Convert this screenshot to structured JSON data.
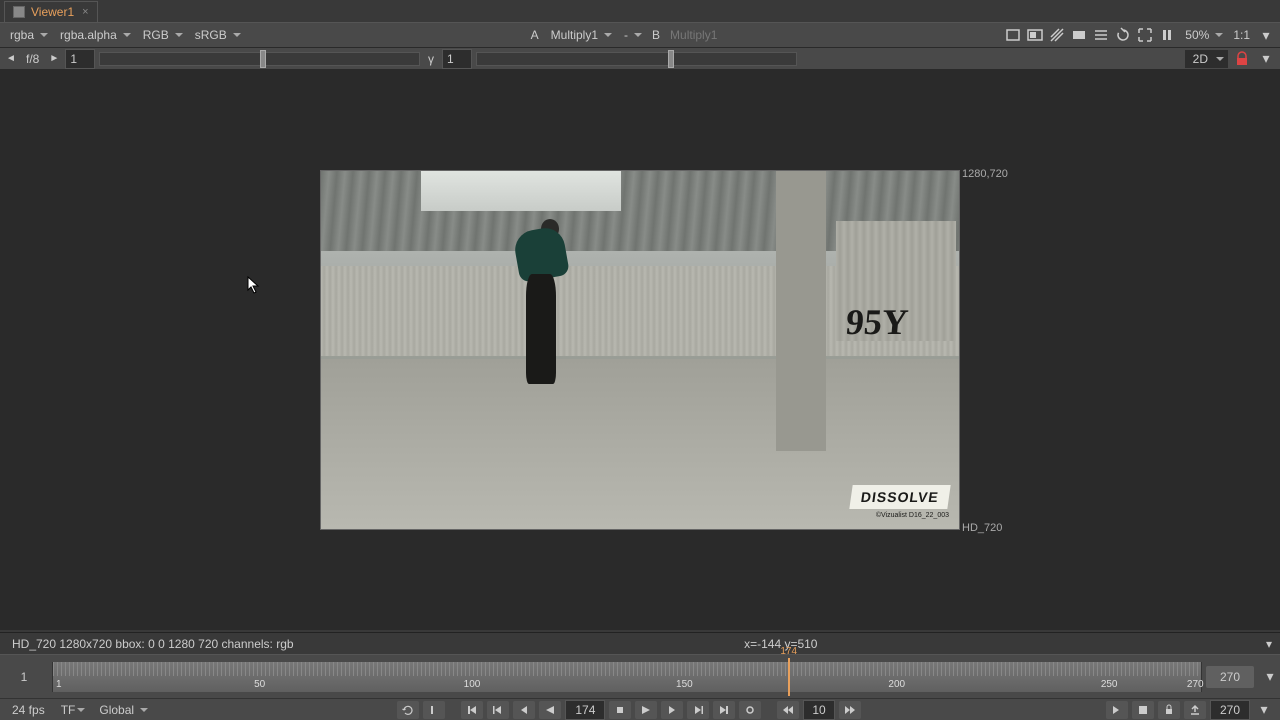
{
  "tab": {
    "title": "Viewer1"
  },
  "toolbar": {
    "layer": "rgba",
    "channel": "rgba.alpha",
    "colorspace": "RGB",
    "display": "sRGB",
    "a_label": "A",
    "a_value": "Multiply1",
    "b_dash": "-",
    "b_label": "B",
    "b_value": "Multiply1",
    "zoom": "50%",
    "ratio": "1:1"
  },
  "sliders": {
    "fstop": "f/8",
    "fstop_val": "1",
    "gamma_label": "γ",
    "gamma_val": "1",
    "view_mode": "2D"
  },
  "viewport": {
    "top_res": "1280,720",
    "bottom_res": "HD_720",
    "graffiti": "95Y",
    "logo": "DISSOLVE",
    "logo_sub": "©Vizualist D16_22_003"
  },
  "status": {
    "info": "HD_720 1280x720  bbox: 0 0 1280 720 channels: rgb",
    "coords": "x=-144 y=510"
  },
  "timeline": {
    "start": "1",
    "ticks": [
      "1",
      "50",
      "100",
      "150",
      "200",
      "250",
      "270"
    ],
    "playhead_frame": "174",
    "end": "270"
  },
  "playback": {
    "fps": "24 fps",
    "tf": "TF",
    "global": "Global",
    "current_frame": "174",
    "skip": "10",
    "end_frame": "270"
  }
}
